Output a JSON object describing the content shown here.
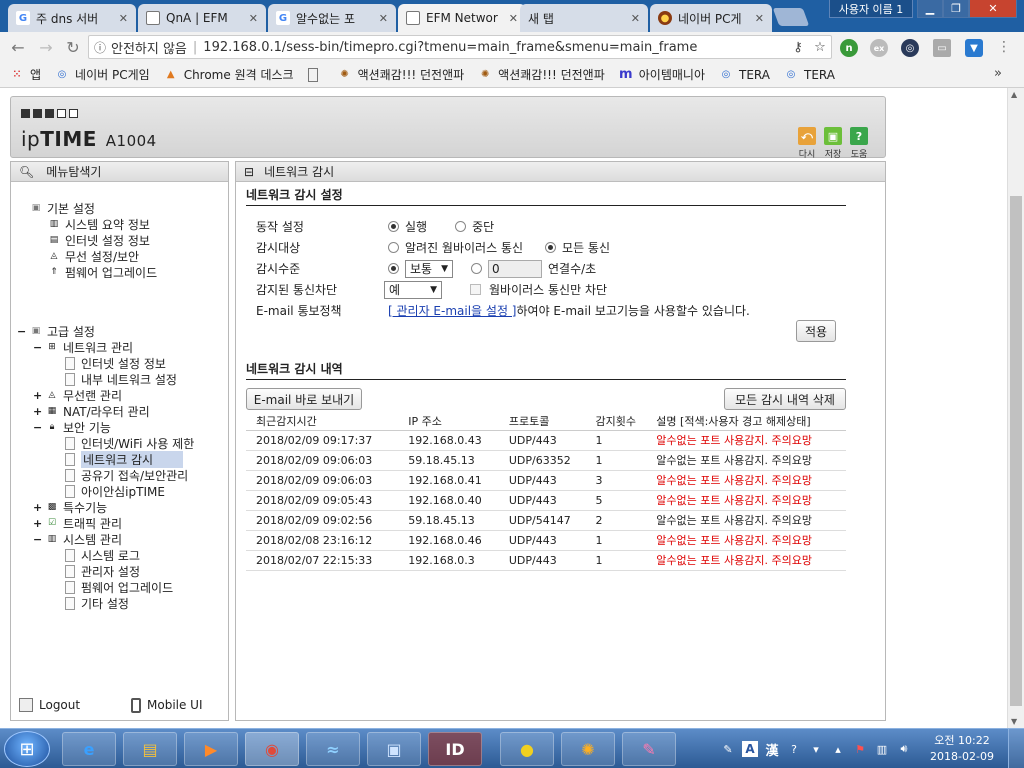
{
  "browser": {
    "tabs": [
      {
        "label": "주 dns 서버",
        "icon": "google-icon",
        "active": false
      },
      {
        "label": "QnA | EFM",
        "icon": "page-icon",
        "active": false
      },
      {
        "label": "알수없는 포",
        "icon": "google-icon",
        "active": false
      },
      {
        "label": "EFM Networ",
        "icon": "page-icon",
        "active": true
      },
      {
        "label": "새 탭",
        "icon": "none",
        "active": false
      },
      {
        "label": "네이버 PC게",
        "icon": "game-icon",
        "active": false
      }
    ],
    "user_name": "사용자 이름 1",
    "address": {
      "security_label": "안전하지 않음",
      "separator": "|",
      "url": "192.168.0.1/sess-bin/timepro.cgi?tmenu=main_frame&smenu=main_frame"
    },
    "bookmarks": [
      {
        "label": "앱",
        "icon": "apps-icon"
      },
      {
        "label": "네이버 PC게임",
        "icon": "naver-game-icon"
      },
      {
        "label": "Chrome 원격 데스크",
        "icon": "chrome-remote-icon"
      },
      {
        "label": "",
        "icon": "page-icon"
      },
      {
        "label": "액션쾌감!!! 던전앤파",
        "icon": "dnf-icon"
      },
      {
        "label": "액션쾌감!!! 던전앤파",
        "icon": "dnf-icon"
      },
      {
        "label": "아이템매니아",
        "icon": "itemmania-icon"
      },
      {
        "label": "TERA",
        "icon": "tera-icon"
      },
      {
        "label": "TERA",
        "icon": "tera-icon"
      }
    ],
    "bookmarks_more": "»"
  },
  "router": {
    "brand_light": "ip",
    "brand_bold": "TIME",
    "model": "A1004",
    "header_buttons": [
      {
        "label": "다시",
        "icon": "back-icon",
        "color": "#e8a23a"
      },
      {
        "label": "저장",
        "icon": "save-icon",
        "color": "#6cbf3a"
      },
      {
        "label": "도움",
        "icon": "help-icon",
        "color": "#3aa64b"
      }
    ]
  },
  "sidebar": {
    "title": "메뉴탐색기",
    "groups": [
      {
        "label": "기본 설정",
        "items": [
          "시스템 요약 정보",
          "인터넷 설정 정보",
          "무선 설정/보안",
          "펌웨어 업그레이드"
        ]
      },
      {
        "label": "고급 설정"
      },
      {
        "label": "네트워크 관리",
        "items": [
          "인터넷 설정 정보",
          "내부 네트워크 설정"
        ]
      },
      {
        "label": "무선랜 관리"
      },
      {
        "label": "NAT/라우터 관리"
      },
      {
        "label": "보안 기능",
        "items": [
          "인터넷/WiFi 사용 제한",
          "네트워크 감시",
          "공유기 접속/보안관리",
          "아이안심ipTIME"
        ]
      },
      {
        "label": "특수기능"
      },
      {
        "label": "트래픽 관리"
      },
      {
        "label": "시스템 관리",
        "items": [
          "시스템 로그",
          "관리자 설정",
          "펌웨어 업그레이드",
          "기타 설정"
        ]
      }
    ],
    "expanders": {
      "minus": "−",
      "plus": "+"
    },
    "footer": {
      "logout": "Logout",
      "mobile": "Mobile UI"
    }
  },
  "main": {
    "title": "네트워크 감시",
    "settings_title": "네트워크 감시 설정",
    "settings": {
      "action": {
        "label": "동작 설정",
        "options": [
          "실행",
          "중단"
        ],
        "selected": "실행"
      },
      "target": {
        "label": "감시대상",
        "options": [
          "알려진 웜바이러스 통신",
          "모든 통신"
        ],
        "selected": "모든 통신"
      },
      "level": {
        "label": "감시수준",
        "select_value": "보통",
        "custom_value": "0",
        "unit": "연결수/초"
      },
      "block": {
        "label": "감지된 통신차단",
        "select_value": "예",
        "checkbox_label": "웜바이러스 통신만 차단"
      },
      "email": {
        "label": "E-mail 통보정책",
        "link": "[ 관리자 E-mail을 설정 ]",
        "text": "하여야 E-mail 보고기능을 사용할수 있습니다."
      }
    },
    "apply_label": "적용",
    "log_title": "네트워크 감시 내역",
    "send_email_label": "E-mail 바로 보내기",
    "delete_all_label": "모든 감시 내역 삭제",
    "log_columns": [
      "최근감지시간",
      "IP 주소",
      "프로토콜",
      "감지횟수",
      "설명 [적색:사용자 경고 해제상태]"
    ],
    "log_rows": [
      {
        "time": "2018/02/09 09:17:37",
        "ip": "192.168.0.43",
        "proto": "UDP/443",
        "count": "1",
        "desc": "알수없는 포트 사용감지. 주의요망",
        "warn": true
      },
      {
        "time": "2018/02/09 09:06:03",
        "ip": "59.18.45.13",
        "proto": "UDP/63352",
        "count": "1",
        "desc": "알수없는 포트 사용감지. 주의요망",
        "warn": false
      },
      {
        "time": "2018/02/09 09:06:03",
        "ip": "192.168.0.41",
        "proto": "UDP/443",
        "count": "3",
        "desc": "알수없는 포트 사용감지. 주의요망",
        "warn": true
      },
      {
        "time": "2018/02/09 09:05:43",
        "ip": "192.168.0.40",
        "proto": "UDP/443",
        "count": "5",
        "desc": "알수없는 포트 사용감지. 주의요망",
        "warn": true
      },
      {
        "time": "2018/02/09 09:02:56",
        "ip": "59.18.45.13",
        "proto": "UDP/54147",
        "count": "2",
        "desc": "알수없는 포트 사용감지. 주의요망",
        "warn": false
      },
      {
        "time": "2018/02/08 23:16:12",
        "ip": "192.168.0.46",
        "proto": "UDP/443",
        "count": "1",
        "desc": "알수없는 포트 사용감지. 주의요망",
        "warn": true
      },
      {
        "time": "2018/02/07 22:15:33",
        "ip": "192.168.0.3",
        "proto": "UDP/443",
        "count": "1",
        "desc": "알수없는 포트 사용감지. 주의요망",
        "warn": true
      }
    ]
  },
  "taskbar": {
    "apps": [
      "internet-explorer-icon",
      "file-explorer-icon",
      "media-player-icon",
      "chrome-icon",
      "dolphin-icon",
      "remote-desktop-icon",
      "id-app-icon",
      "kakaotalk-icon",
      "game-icon",
      "paint-icon"
    ],
    "ime_a": "A",
    "ime_han": "漢",
    "time": "오전 10:22",
    "date": "2018-02-09"
  },
  "colors": {
    "warn": "#dd0000",
    "link": "#1a3fb0",
    "selected_row": "#c9d6ec"
  }
}
